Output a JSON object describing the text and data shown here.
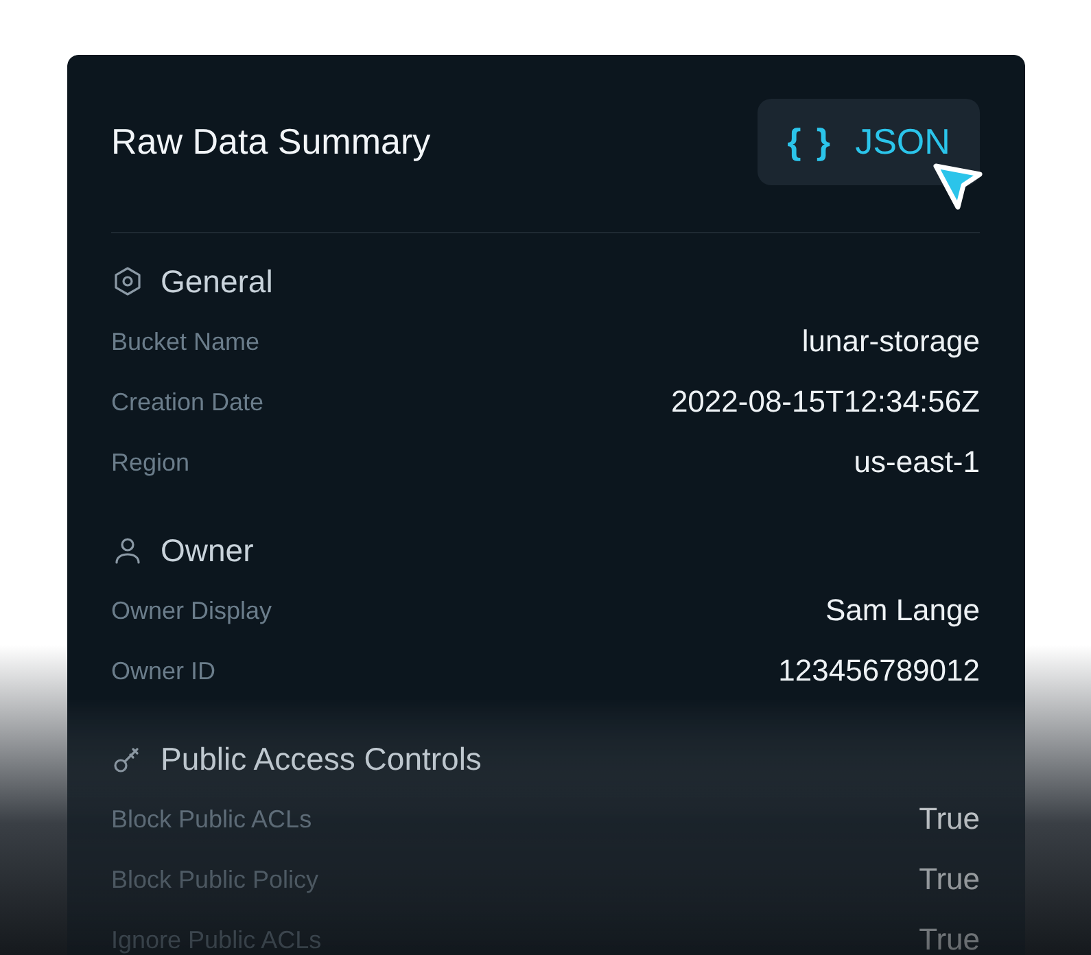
{
  "card": {
    "title": "Raw Data Summary",
    "button": {
      "braces": "{ }",
      "label": "JSON"
    }
  },
  "sections": [
    {
      "kind": "settings",
      "title": "General",
      "rows": [
        {
          "label": "Bucket Name",
          "value": "lunar-storage"
        },
        {
          "label": "Creation Date",
          "value": "2022-08-15T12:34:56Z"
        },
        {
          "label": "Region",
          "value": "us-east-1"
        }
      ]
    },
    {
      "kind": "user",
      "title": "Owner",
      "rows": [
        {
          "label": "Owner Display",
          "value": "Sam Lange"
        },
        {
          "label": "Owner ID",
          "value": "123456789012"
        }
      ]
    },
    {
      "kind": "key",
      "title": "Public Access Controls",
      "rows": [
        {
          "label": "Block Public ACLs",
          "value": "True"
        },
        {
          "label": "Block Public Policy",
          "value": "True"
        },
        {
          "label": "Ignore Public ACLs",
          "value": "True"
        }
      ]
    }
  ]
}
